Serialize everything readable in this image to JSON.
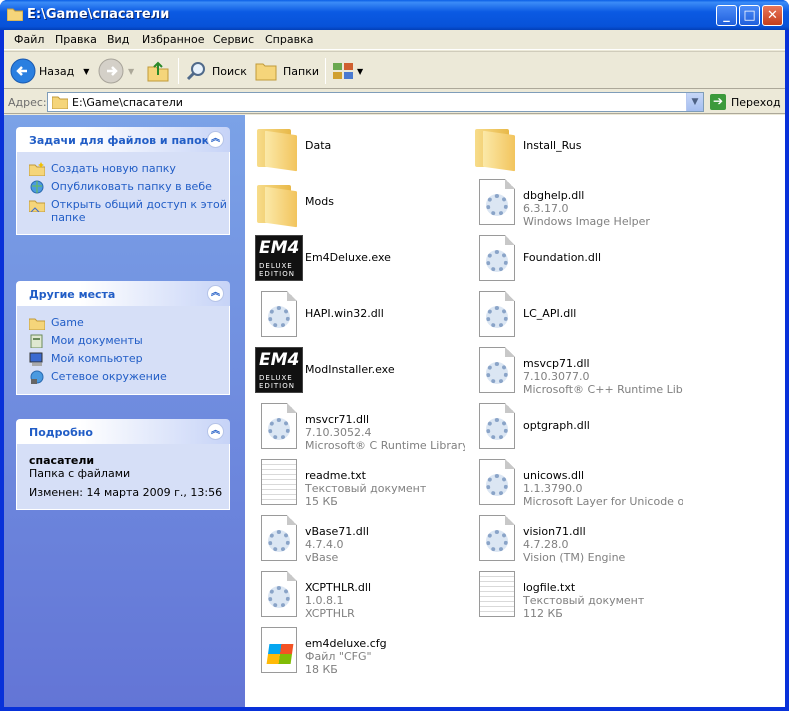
{
  "window": {
    "title": "E:\\Game\\спасатели",
    "minimize": "_",
    "maximize": "□",
    "close": "✕"
  },
  "menu": [
    "Файл",
    "Правка",
    "Вид",
    "Избранное",
    "Сервис",
    "Справка"
  ],
  "toolbar": {
    "back": "Назад",
    "search": "Поиск",
    "folders": "Папки"
  },
  "address": {
    "label": "Адрес:",
    "value": "E:\\Game\\спасатели",
    "go": "Переход"
  },
  "sidebar": {
    "tasks": {
      "title": "Задачи для файлов и папок",
      "items": [
        "Создать новую папку",
        "Опубликовать папку в вебе",
        "Открыть общий доступ к этой папке"
      ]
    },
    "places": {
      "title": "Другие места",
      "items": [
        "Game",
        "Мои документы",
        "Мой компьютер",
        "Сетевое окружение"
      ]
    },
    "details": {
      "title": "Подробно",
      "name": "спасатели",
      "type": "Папка с файлами",
      "modified": "Изменен: 14 марта 2009 г., 13:56"
    }
  },
  "files": [
    {
      "name": "Data",
      "icon": "folder-icon",
      "l2": "",
      "l3": ""
    },
    {
      "name": "Install_Rus",
      "icon": "folder-icon",
      "l2": "",
      "l3": ""
    },
    {
      "name": "Mods",
      "icon": "folder-icon",
      "l2": "",
      "l3": ""
    },
    {
      "name": "dbghelp.dll",
      "icon": "dll-icon",
      "l2": "6.3.17.0",
      "l3": "Windows Image Helper"
    },
    {
      "name": "Em4Deluxe.exe",
      "icon": "em4-exe-icon",
      "l2": "",
      "l3": ""
    },
    {
      "name": "Foundation.dll",
      "icon": "dll-icon",
      "l2": "",
      "l3": ""
    },
    {
      "name": "HAPI.win32.dll",
      "icon": "dll-icon",
      "l2": "",
      "l3": ""
    },
    {
      "name": "LC_API.dll",
      "icon": "dll-icon",
      "l2": "",
      "l3": ""
    },
    {
      "name": "ModInstaller.exe",
      "icon": "em4-exe-icon",
      "l2": "",
      "l3": ""
    },
    {
      "name": "msvcp71.dll",
      "icon": "dll-icon",
      "l2": "7.10.3077.0",
      "l3": "Microsoft® C++ Runtime Library"
    },
    {
      "name": "msvcr71.dll",
      "icon": "dll-icon",
      "l2": "7.10.3052.4",
      "l3": "Microsoft® C Runtime Library"
    },
    {
      "name": "optgraph.dll",
      "icon": "dll-icon",
      "l2": "",
      "l3": ""
    },
    {
      "name": "readme.txt",
      "icon": "text-document-icon",
      "l2": "Текстовый документ",
      "l3": "15 КБ"
    },
    {
      "name": "unicows.dll",
      "icon": "dll-icon",
      "l2": "1.1.3790.0",
      "l3": "Microsoft Layer for Unicode o..."
    },
    {
      "name": "vBase71.dll",
      "icon": "dll-icon",
      "l2": "4.7.4.0",
      "l3": "vBase"
    },
    {
      "name": "vision71.dll",
      "icon": "dll-icon",
      "l2": "4.7.28.0",
      "l3": "Vision (TM) Engine"
    },
    {
      "name": "XCPTHLR.dll",
      "icon": "dll-icon",
      "l2": "1.0.8.1",
      "l3": "XCPTHLR"
    },
    {
      "name": "logfile.txt",
      "icon": "text-document-icon",
      "l2": "Текстовый документ",
      "l3": "112 КБ"
    },
    {
      "name": "em4deluxe.cfg",
      "icon": "cfg-file-icon",
      "l2": "Файл \"CFG\"",
      "l3": "18 КБ"
    }
  ],
  "em4": {
    "big": "EM4",
    "small": "DELUXE EDITION"
  }
}
